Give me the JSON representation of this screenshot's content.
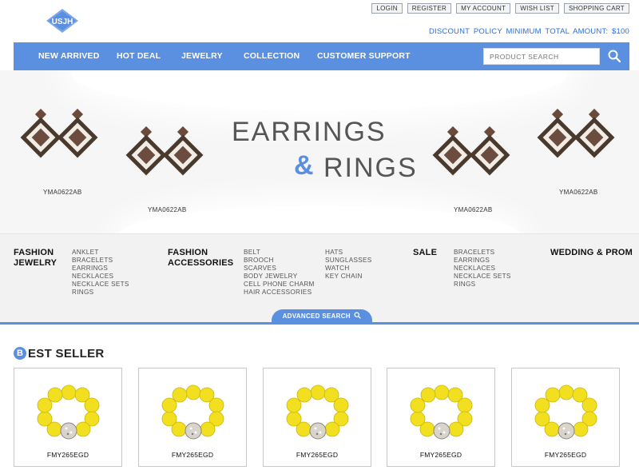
{
  "header": {
    "logo_text": "USJH",
    "top_links": [
      "LOGIN",
      "REGISTER",
      "MY ACCOUNT",
      "WISH LIST",
      "SHOPPING CART"
    ],
    "discount_text": "DISCOUNT POLICY  MINIMUM TOTAL AMOUNT: $100"
  },
  "nav": {
    "items": [
      "NEW ARRIVED",
      "HOT DEAL",
      "JEWELRY",
      "COLLECTION",
      "CUSTOMER SUPPORT"
    ],
    "search_placeholder": "PRODUCT SEARCH"
  },
  "banner": {
    "title_line1": "EARRINGS",
    "title_amp": "&",
    "title_line2": "RINGS",
    "product_labels": [
      "YMA0622AB",
      "YMA0622AB",
      "YMA0622AB",
      "YMA0622AB"
    ]
  },
  "categories": [
    {
      "heading_1": "FASHION",
      "heading_2": "JEWELRY",
      "items": [
        "ANKLET",
        "BRACELETS",
        "EARRINGS",
        "NECKLACES",
        "NECKLACE SETS",
        "RINGS"
      ]
    },
    {
      "heading_1": "FASHION",
      "heading_2": "ACCESSORIES",
      "items": [
        "BELT",
        "BROOCH",
        "SCARVES",
        "BODY JEWELRY",
        "CELL PHONE CHARM",
        "HAIR ACCESSORIES"
      ],
      "items_col2": [
        "HATS",
        "SUNGLASSES",
        "WATCH",
        "KEY CHAIN"
      ]
    },
    {
      "heading_1": "SALE",
      "items": [
        "BRACELETS",
        "EARRINGS",
        "NECKLACES",
        "NECKLACE SETS",
        "RINGS"
      ]
    },
    {
      "heading_1": "WEDDING & PROM"
    }
  ],
  "advanced_search": "ADVANCED SEARCH",
  "best_seller": {
    "title_initial": "B",
    "title_rest": "EST SELLER",
    "products": [
      "FMY265EGD",
      "FMY265EGD",
      "FMY265EGD",
      "FMY265EGD",
      "FMY265EGD"
    ]
  },
  "colors": {
    "accent": "#5b8fe0",
    "bead": "#f2df1f",
    "earring_brown": "#6a4a3a"
  }
}
